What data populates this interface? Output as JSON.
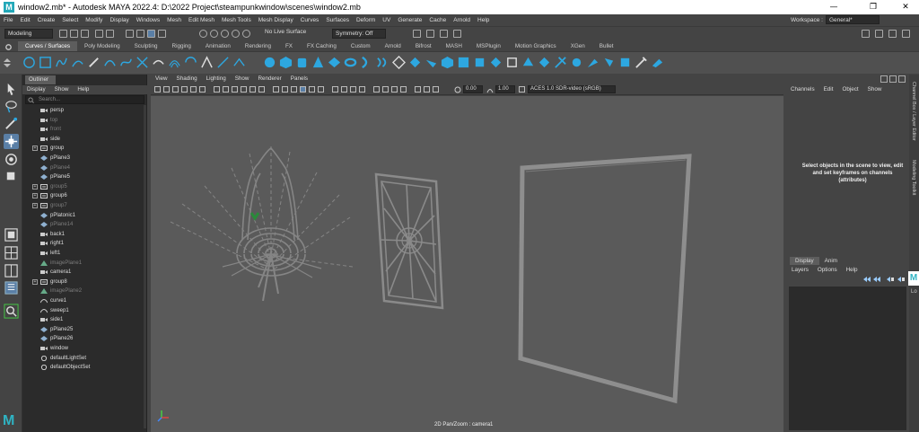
{
  "window": {
    "title": "window2.mb* - Autodesk MAYA 2022.4: D:\\2022 Project\\steampunkwindow\\scenes\\window2.mb",
    "app_icon": "M",
    "controls": [
      "—",
      "❐",
      "✕"
    ]
  },
  "menubar": {
    "items": [
      "File",
      "Edit",
      "Create",
      "Select",
      "Modify",
      "Display",
      "Windows",
      "Mesh",
      "Edit Mesh",
      "Mesh Tools",
      "Mesh Display",
      "Curves",
      "Surfaces",
      "Deform",
      "UV",
      "Generate",
      "Cache",
      "Arnold",
      "Help"
    ],
    "workspace_label": "Workspace :",
    "workspace_value": "General*"
  },
  "statusline": {
    "mode": "Modeling",
    "live_surface": "No Live Surface",
    "symmetry": "Symmetry: Off"
  },
  "shelf": {
    "tabs": [
      "Curves / Surfaces",
      "Poly Modeling",
      "Sculpting",
      "Rigging",
      "Animation",
      "Rendering",
      "FX",
      "FX Caching",
      "Custom",
      "Arnold",
      "Bifrost",
      "MASH",
      "MSPlugin",
      "Motion Graphics",
      "XGen",
      "Bullet"
    ],
    "active_tab": 0
  },
  "outliner": {
    "tab": "Outliner",
    "menu": [
      "Display",
      "Show",
      "Help"
    ],
    "search_placeholder": "Search...",
    "items": [
      {
        "label": "persp",
        "icon": "camera-icon",
        "dim": false,
        "expand": false
      },
      {
        "label": "top",
        "icon": "camera-icon",
        "dim": true,
        "expand": false
      },
      {
        "label": "front",
        "icon": "camera-icon",
        "dim": true,
        "expand": false
      },
      {
        "label": "side",
        "icon": "camera-icon",
        "dim": false,
        "expand": false
      },
      {
        "label": "group",
        "icon": "group-icon",
        "dim": false,
        "expand": true
      },
      {
        "label": "pPlane3",
        "icon": "mesh-icon",
        "dim": false,
        "expand": false
      },
      {
        "label": "pPlane4",
        "icon": "mesh-icon",
        "dim": true,
        "expand": false
      },
      {
        "label": "pPlane5",
        "icon": "mesh-icon",
        "dim": false,
        "expand": false
      },
      {
        "label": "group5",
        "icon": "group-icon",
        "dim": true,
        "expand": true
      },
      {
        "label": "group6",
        "icon": "group-icon",
        "dim": false,
        "expand": true
      },
      {
        "label": "group7",
        "icon": "group-icon",
        "dim": true,
        "expand": true
      },
      {
        "label": "pPlatonic1",
        "icon": "mesh-icon",
        "dim": false,
        "expand": false
      },
      {
        "label": "pPlane14",
        "icon": "mesh-icon",
        "dim": true,
        "expand": false
      },
      {
        "label": "back1",
        "icon": "camera-icon",
        "dim": false,
        "expand": false
      },
      {
        "label": "right1",
        "icon": "camera-icon",
        "dim": false,
        "expand": false
      },
      {
        "label": "left1",
        "icon": "camera-icon",
        "dim": false,
        "expand": false
      },
      {
        "label": "imagePlane1",
        "icon": "imageplane-icon",
        "dim": true,
        "expand": false
      },
      {
        "label": "camera1",
        "icon": "camera-icon",
        "dim": false,
        "expand": false
      },
      {
        "label": "group8",
        "icon": "group-icon",
        "dim": false,
        "expand": true
      },
      {
        "label": "imagePlane2",
        "icon": "imageplane-icon",
        "dim": true,
        "expand": false
      },
      {
        "label": "curve1",
        "icon": "curve-icon",
        "dim": false,
        "expand": false
      },
      {
        "label": "sweep1",
        "icon": "curve-icon",
        "dim": false,
        "expand": false
      },
      {
        "label": "side1",
        "icon": "camera-icon",
        "dim": false,
        "expand": false
      },
      {
        "label": "pPlane25",
        "icon": "mesh-icon",
        "dim": false,
        "expand": false
      },
      {
        "label": "pPlane26",
        "icon": "mesh-icon",
        "dim": false,
        "expand": false
      },
      {
        "label": "window",
        "icon": "camera-icon",
        "dim": false,
        "expand": false
      },
      {
        "label": "defaultLightSet",
        "icon": "set-icon",
        "dim": false,
        "expand": false
      },
      {
        "label": "defaultObjectSet",
        "icon": "set-icon",
        "dim": false,
        "expand": false
      }
    ]
  },
  "viewport": {
    "menu": [
      "View",
      "Shading",
      "Lighting",
      "Show",
      "Renderer",
      "Panels"
    ],
    "exposure": "0.00",
    "gamma": "1.00",
    "color_space": "ACES 1.0 SDR-video (sRGB)",
    "camera_label": "2D Pan/Zoom : camera1"
  },
  "channelbox": {
    "menu": [
      "Channels",
      "Edit",
      "Object",
      "Show"
    ],
    "message": "Select objects in the scene to view, edit and set keyframes on channels (attributes)"
  },
  "layereditor": {
    "tabs": [
      "Display",
      "Anim"
    ],
    "menu": [
      "Layers",
      "Options",
      "Help"
    ]
  },
  "sidebar_right": {
    "label1": "Channel Box / Layer Editor",
    "label2": "Modeling Toolkit",
    "floating_app_icon": "M",
    "floating_app_label": "Lo"
  },
  "logo": "M",
  "colors": {
    "accent": "#23a8b8",
    "viewport_bg": "#5a5a5a",
    "panel_bg": "#444444",
    "outliner_bg": "#2b2b2b",
    "active_tool": "#5a7fa6"
  }
}
